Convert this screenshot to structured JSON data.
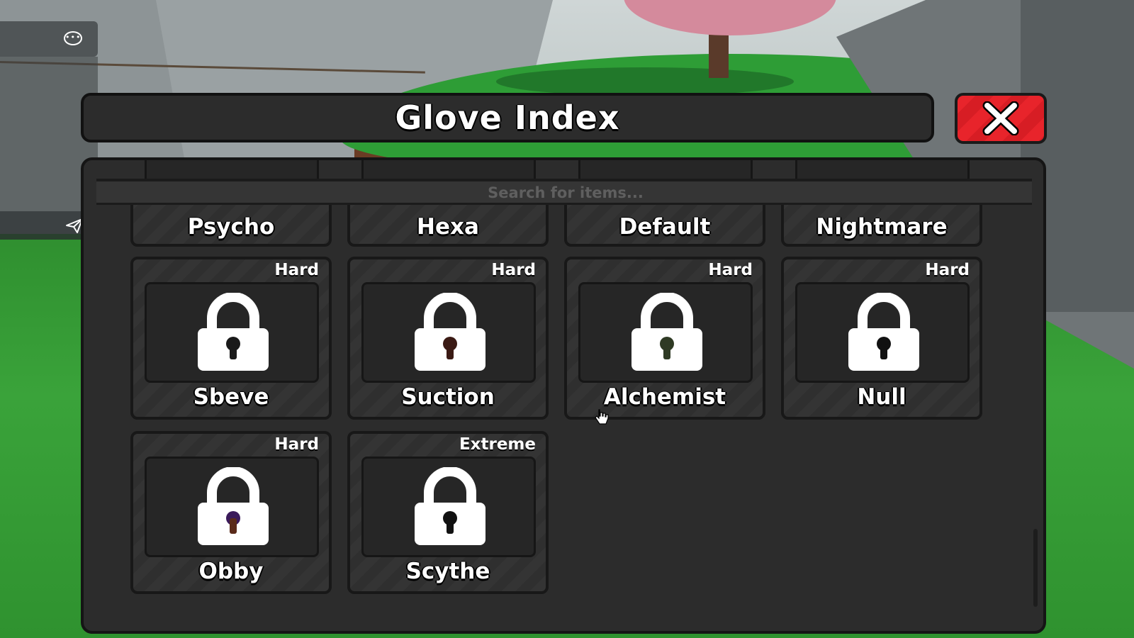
{
  "title": "Glove Index",
  "close_icon": "close-x-icon",
  "search": {
    "placeholder": "Search for items..."
  },
  "colors": {
    "panel": "#2c2c2c",
    "close_button": "#e8242b",
    "text": "#ffffff"
  },
  "top_row": [
    {
      "name": "Psycho"
    },
    {
      "name": "Hexa"
    },
    {
      "name": "Default"
    },
    {
      "name": "Nightmare"
    }
  ],
  "row2": [
    {
      "name": "Sbeve",
      "difficulty": "Hard"
    },
    {
      "name": "Suction",
      "difficulty": "Hard"
    },
    {
      "name": "Alchemist",
      "difficulty": "Hard"
    },
    {
      "name": "Null",
      "difficulty": "Hard"
    }
  ],
  "row3": [
    {
      "name": "Obby",
      "difficulty": "Hard"
    },
    {
      "name": "Scythe",
      "difficulty": "Extreme"
    }
  ],
  "chat": {
    "menu_icon": "more-options-icon",
    "send_icon": "send-icon"
  },
  "card_icon": "lock-icon"
}
